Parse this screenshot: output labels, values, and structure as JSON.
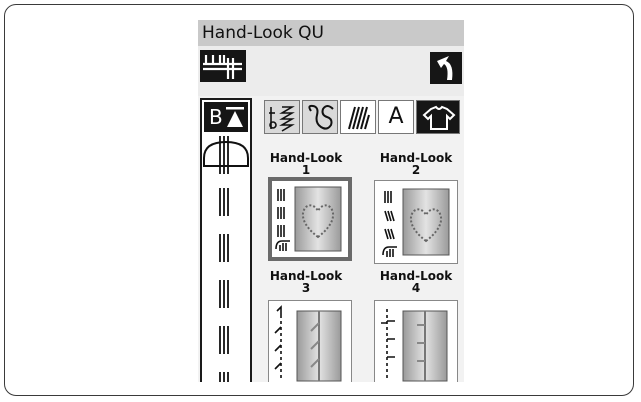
{
  "screen": {
    "title": "Hand-Look QU"
  },
  "toolbar": {
    "needle_icon": "needle-plate-icon",
    "back_icon": "back-arrow-icon"
  },
  "left_column": {
    "mode_button_label": "B"
  },
  "categories": [
    {
      "icon": "utility-stitch-icon"
    },
    {
      "icon": "decorative-stitch-icon"
    },
    {
      "icon": "satin-stitch-icon"
    },
    {
      "label": "A"
    },
    {
      "icon": "shirt-icon"
    }
  ],
  "patterns": [
    {
      "label_line1": "Hand-Look",
      "label_line2": "1",
      "selected": true
    },
    {
      "label_line1": "Hand-Look",
      "label_line2": "2",
      "selected": false
    },
    {
      "label_line1": "Hand-Look",
      "label_line2": "3",
      "selected": false
    },
    {
      "label_line1": "Hand-Look",
      "label_line2": "4",
      "selected": false
    }
  ]
}
